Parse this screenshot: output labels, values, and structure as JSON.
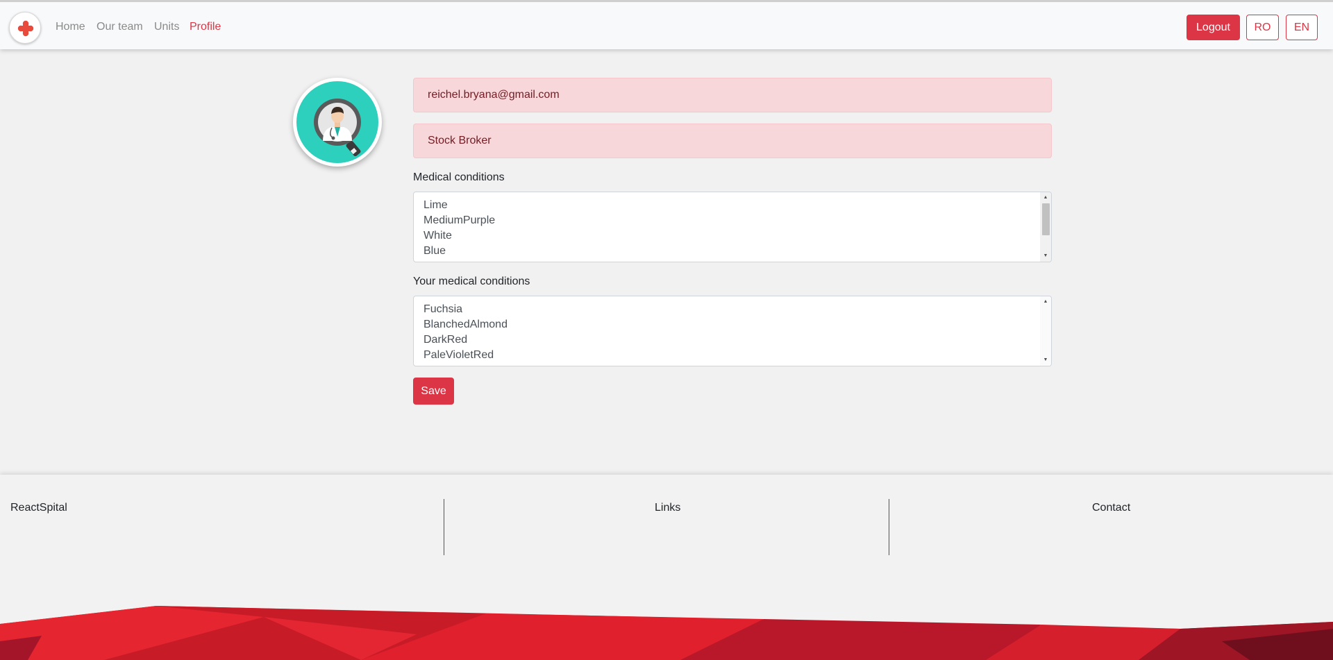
{
  "nav": {
    "links": [
      {
        "label": "Home",
        "active": false
      },
      {
        "label": "Our team",
        "active": false
      },
      {
        "label": "Units",
        "active": false
      },
      {
        "label": "Profile",
        "active": true
      }
    ],
    "logout_label": "Logout",
    "lang_ro": "RO",
    "lang_en": "EN"
  },
  "profile": {
    "email": "reichel.bryana@gmail.com",
    "job": "Stock Broker"
  },
  "medical_conditions": {
    "label": "Medical conditions",
    "options": [
      "Lime",
      "MediumPurple",
      "White",
      "Blue"
    ]
  },
  "your_medical_conditions": {
    "label": "Your medical conditions",
    "options": [
      "Fuchsia",
      "BlanchedAlmond",
      "DarkRed",
      "PaleVioletRed"
    ]
  },
  "save_label": "Save",
  "footer": {
    "brand": "ReactSpital",
    "links": "Links",
    "contact": "Contact"
  },
  "colors": {
    "accent": "#dc3545",
    "avatar_bg": "#2dcfbd",
    "alert_bg": "#f8d7da"
  }
}
